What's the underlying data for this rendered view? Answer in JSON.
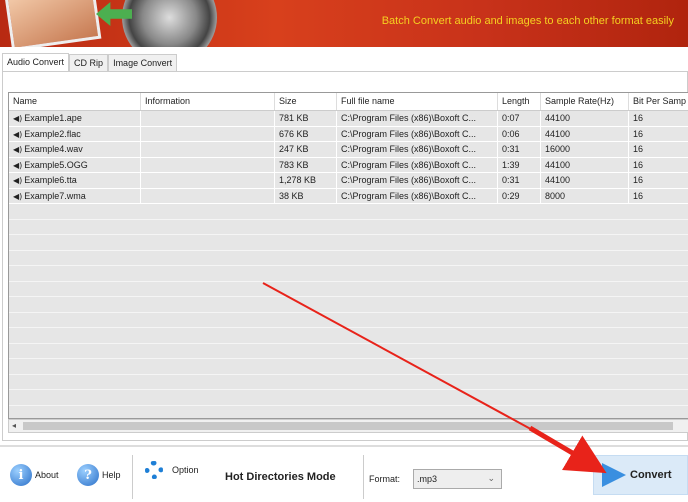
{
  "banner": {
    "tagline": "Batch Convert  audio and images to each other format easily"
  },
  "tabs": [
    "Audio Convert",
    "CD Rip",
    "Image Convert"
  ],
  "table": {
    "columns": [
      "Name",
      "Information",
      "Size",
      "Full file name",
      "Length",
      "Sample Rate(Hz)",
      "Bit Per Samp"
    ],
    "rows": [
      [
        "Example1.ape",
        "",
        "781 KB",
        "C:\\Program Files (x86)\\Boxoft C...",
        "0:07",
        "44100",
        "16"
      ],
      [
        "Example2.flac",
        "",
        "676 KB",
        "C:\\Program Files (x86)\\Boxoft C...",
        "0:06",
        "44100",
        "16"
      ],
      [
        "Example4.wav",
        "",
        "247 KB",
        "C:\\Program Files (x86)\\Boxoft C...",
        "0:31",
        "16000",
        "16"
      ],
      [
        "Example5.OGG",
        "",
        "783 KB",
        "C:\\Program Files (x86)\\Boxoft C...",
        "1:39",
        "44100",
        "16"
      ],
      [
        "Example6.tta",
        "",
        "1,278 KB",
        "C:\\Program Files (x86)\\Boxoft C...",
        "0:31",
        "44100",
        "16"
      ],
      [
        "Example7.wma",
        "",
        "38 KB",
        "C:\\Program Files (x86)\\Boxoft C...",
        "0:29",
        "8000",
        "16"
      ]
    ]
  },
  "toolbar": {
    "about": "About",
    "help": "Help",
    "option": "Option",
    "hot_mode": "Hot Directories Mode",
    "format_label": "Format:",
    "format_value": ".mp3",
    "convert": "Convert"
  },
  "colors": {
    "annotation_arrow": "#e8231a",
    "banner": "#c8321a"
  }
}
